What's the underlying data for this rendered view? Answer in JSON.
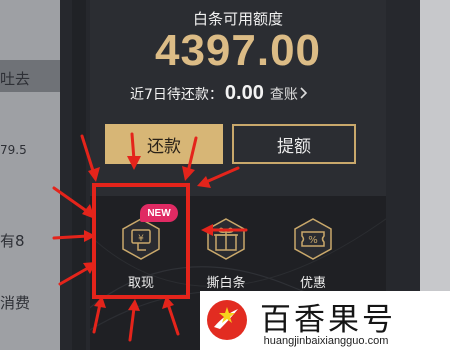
{
  "left_panel": {
    "fragments": [
      "吐去",
      "79.5",
      "有8",
      "消费"
    ]
  },
  "credit": {
    "label": "白条可用额度",
    "amount": "4397.00",
    "repay_label": "近7日待还款：",
    "repay_value": "0.00",
    "bill_link": "查账"
  },
  "buttons": {
    "repay": "还款",
    "raise": "提额"
  },
  "actions": [
    {
      "label": "取现",
      "icon": "cash-withdraw-icon"
    },
    {
      "label": "撕白条",
      "icon": "gift-icon"
    },
    {
      "label": "优惠",
      "icon": "coupon-icon"
    }
  ],
  "badge": "NEW",
  "watermark": {
    "name": "百香果号",
    "url": "huangjinbaixiangguo.com"
  },
  "colors": {
    "gold": "#dcbc86",
    "button_gold": "#d7b676",
    "highlight_red": "#e4241b",
    "badge_pink": "#e02a63"
  }
}
